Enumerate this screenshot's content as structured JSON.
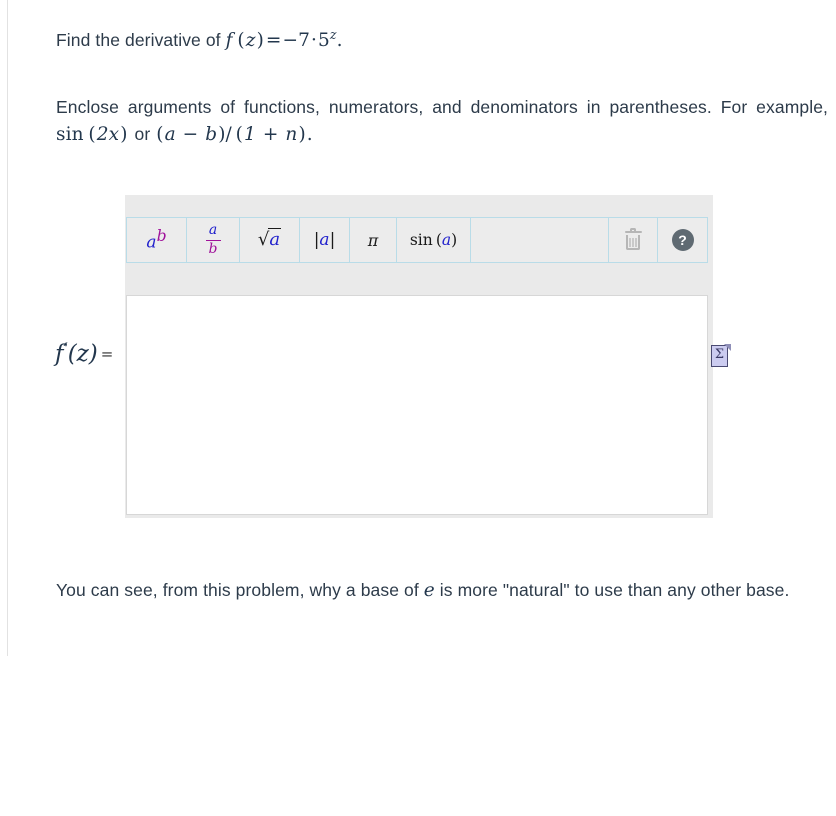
{
  "prompt": {
    "lead": "Find the derivative of",
    "math": {
      "fn": "f",
      "var": "z",
      "equals": "=",
      "coefficient": "−7",
      "dot": "·",
      "base": "5",
      "exponent": "z",
      "period": ".",
      "plain": "f (z) = −7 · 5^z."
    }
  },
  "instruction": {
    "part1": "Enclose arguments of functions, numerators, and denominators in parentheses. For example,",
    "example1": "sin (2x)",
    "conjunction": "or",
    "example2": "(a − b)/(1 + n)",
    "period": ".",
    "plain": "Enclose arguments of functions, numerators, and denominators in parentheses. For example, sin (2x) or (a − b)/(1 + n)."
  },
  "answer_area": {
    "label": {
      "fn": "f",
      "prime": "′",
      "var": "(z)",
      "equals": "=",
      "plain": "f′(z) ="
    },
    "input_value": "",
    "input_placeholder": "",
    "sigma_icon": "math-document-icon",
    "sigma_glyph": "Σ"
  },
  "toolbar": {
    "buttons": [
      {
        "name": "exponent-button",
        "label": "a^b",
        "base": "a",
        "exponent": "b"
      },
      {
        "name": "fraction-button",
        "label": "a/b",
        "numerator": "a",
        "denominator": "b"
      },
      {
        "name": "square-root-button",
        "label": "√a",
        "radical": "√",
        "radicand": "a"
      },
      {
        "name": "absolute-value-button",
        "label": "|a|",
        "bar": "|",
        "inner": "a"
      },
      {
        "name": "pi-button",
        "label": "π"
      },
      {
        "name": "sine-button",
        "label": "sin (a)",
        "fn": "sin",
        "open": "(",
        "arg": "a",
        "close": ")"
      }
    ],
    "delete_button": {
      "name": "trash-icon",
      "label": "Delete"
    },
    "help_button": {
      "name": "help-icon",
      "label": "?"
    }
  },
  "closing": {
    "part1": "You can see, from this problem, why a base of",
    "math_e": "e",
    "part2": "is more \"natural\" to use than any other base.",
    "plain": "You can see, from this problem, why a base of e is more \"natural\" to use than any other base."
  },
  "colors": {
    "text": "#2d3b4a",
    "math": "#23374d",
    "variable_a": "#2222cc",
    "variable_b": "#a0129a",
    "panel_bg": "#eaeaea",
    "toolbar_border": "#b9dce8",
    "toolbar_btn_bg": "#ececec",
    "field_bg": "#ffffff",
    "field_border": "#d7d7d7",
    "icon_gray": "#b6b6b6",
    "help_bg": "#5f6a72",
    "sigma_fill": "#ccccf0"
  }
}
